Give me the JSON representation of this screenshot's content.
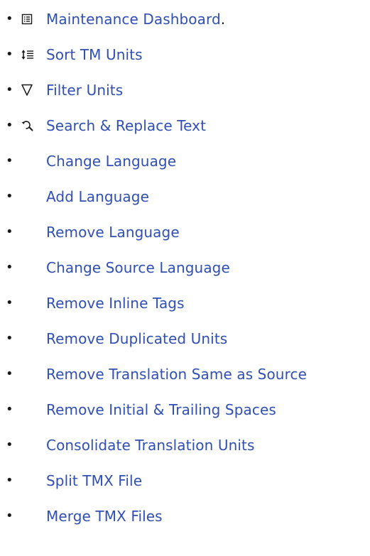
{
  "menu": {
    "bullet": "•",
    "items": [
      {
        "label": "Maintenance Dashboard",
        "suffix": ".",
        "icon": "dashboard-icon"
      },
      {
        "label": "Sort TM Units",
        "icon": "sort-icon"
      },
      {
        "label": "Filter Units",
        "icon": "filter-icon"
      },
      {
        "label": "Search & Replace Text",
        "icon": "search-replace-icon"
      },
      {
        "label": "Change Language"
      },
      {
        "label": "Add Language"
      },
      {
        "label": "Remove Language"
      },
      {
        "label": "Change Source Language"
      },
      {
        "label": "Remove Inline Tags"
      },
      {
        "label": "Remove Duplicated Units"
      },
      {
        "label": "Remove Translation Same as Source"
      },
      {
        "label": "Remove Initial & Trailing Spaces"
      },
      {
        "label": "Consolidate Translation Units"
      },
      {
        "label": "Split TMX File"
      },
      {
        "label": "Merge TMX Files"
      }
    ]
  },
  "colors": {
    "link": "#2f4fb5",
    "text": "#1a1a1a",
    "background": "#ffffff"
  }
}
